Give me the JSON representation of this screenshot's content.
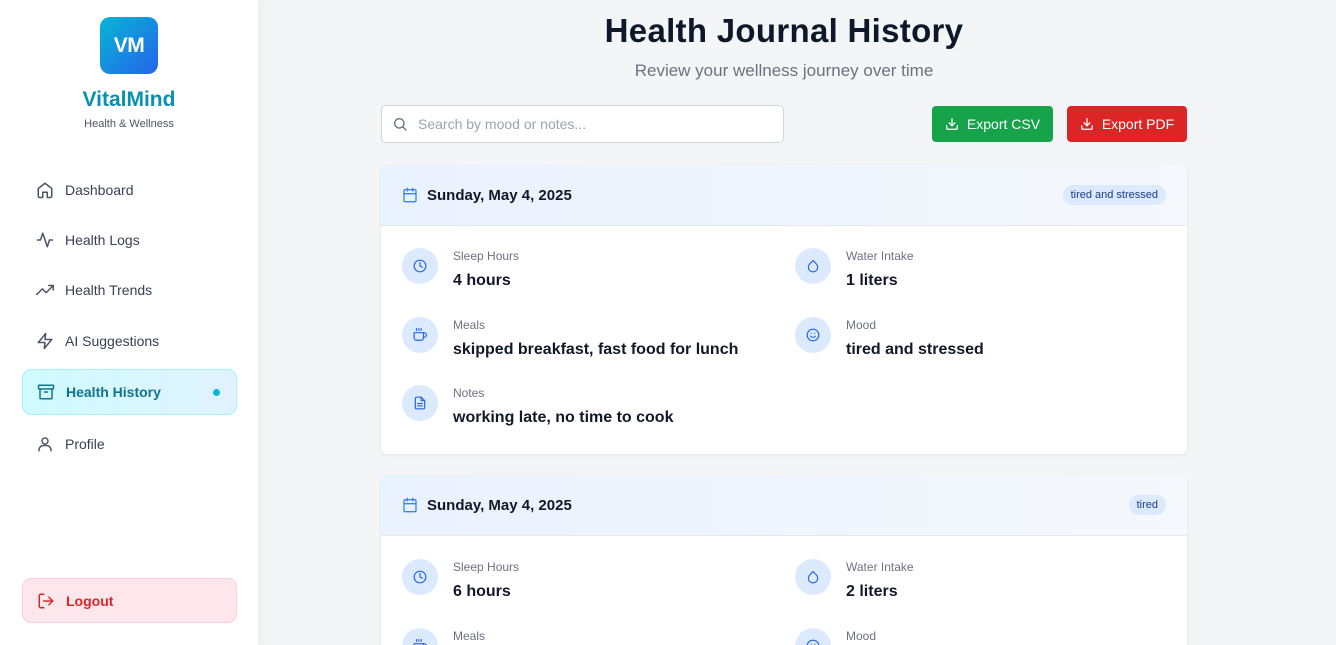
{
  "app": {
    "logo": "VM",
    "name": "VitalMind",
    "tagline": "Health & Wellness"
  },
  "colors": {
    "accent": "#06b6d4",
    "export_csv": "#16a34a",
    "export_pdf": "#dc2626",
    "logout": "#dc2626"
  },
  "sidebar": {
    "items": [
      {
        "label": "Dashboard",
        "icon": "home-icon"
      },
      {
        "label": "Health Logs",
        "icon": "activity-icon"
      },
      {
        "label": "Health Trends",
        "icon": "trending-up-icon"
      },
      {
        "label": "AI Suggestions",
        "icon": "zap-icon"
      },
      {
        "label": "Health History",
        "icon": "archive-icon",
        "active": true
      },
      {
        "label": "Profile",
        "icon": "user-icon"
      }
    ],
    "logout_label": "Logout"
  },
  "header": {
    "title": "Health Journal History",
    "subtitle": "Review your wellness journey over time"
  },
  "search": {
    "placeholder": "Search by mood or notes..."
  },
  "toolbar": {
    "export_csv_label": "Export CSV",
    "export_pdf_label": "Export PDF"
  },
  "entries": [
    {
      "date": "Sunday, May 4, 2025",
      "badge": "tired and stressed",
      "sleep_label": "Sleep Hours",
      "sleep_value": "4 hours",
      "water_label": "Water Intake",
      "water_value": "1 liters",
      "meals_label": "Meals",
      "meals_value": "skipped breakfast, fast food for lunch",
      "mood_label": "Mood",
      "mood_value": "tired and stressed",
      "notes_label": "Notes",
      "notes_value": "working late, no time to cook"
    },
    {
      "date": "Sunday, May 4, 2025",
      "badge": "tired",
      "sleep_label": "Sleep Hours",
      "sleep_value": "6 hours",
      "water_label": "Water Intake",
      "water_value": "2 liters",
      "meals_label": "Meals",
      "mood_label": "Mood"
    }
  ]
}
